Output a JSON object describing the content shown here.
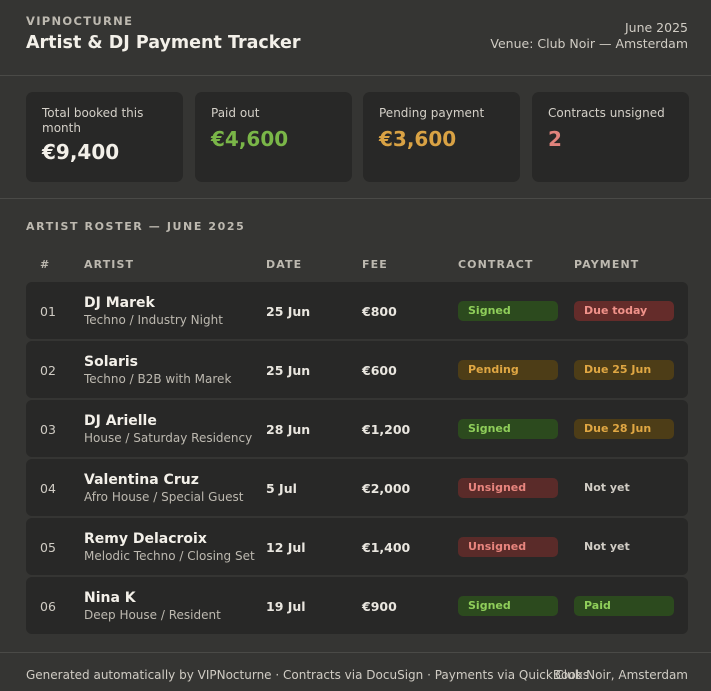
{
  "header": {
    "brand": "VIPNOCTURNE",
    "title": "Artist & DJ Payment Tracker",
    "period": "June 2025",
    "venue": "Venue: Club Noir — Amsterdam"
  },
  "stats": [
    {
      "label": "Total booked this month",
      "value": "€9,400",
      "color": "#f3f0e9"
    },
    {
      "label": "Paid out",
      "value": "€4,600",
      "color": "#7ab648"
    },
    {
      "label": "Pending payment",
      "value": "€3,600",
      "color": "#d9a244"
    },
    {
      "label": "Contracts unsigned",
      "value": "2",
      "color": "#e0837c"
    }
  ],
  "roster": {
    "title": "ARTIST ROSTER — JUNE 2025",
    "columns": [
      "#",
      "ARTIST",
      "DATE",
      "FEE",
      "CONTRACT",
      "PAYMENT"
    ],
    "rows": [
      {
        "num": "01",
        "name": "DJ Marek",
        "genre": "Techno / Industry Night",
        "date": "25 Jun",
        "fee": "€800",
        "contract": "Signed",
        "payment": "Due today"
      },
      {
        "num": "02",
        "name": "Solaris",
        "genre": "Techno / B2B with Marek",
        "date": "25 Jun",
        "fee": "€600",
        "contract": "Pending",
        "payment": "Due 25 Jun"
      },
      {
        "num": "03",
        "name": "DJ Arielle",
        "genre": "House / Saturday Residency",
        "date": "28 Jun",
        "fee": "€1,200",
        "contract": "Signed",
        "payment": "Due 28 Jun"
      },
      {
        "num": "04",
        "name": "Valentina Cruz",
        "genre": "Afro House / Special Guest",
        "date": "5 Jul",
        "fee": "€2,000",
        "contract": "Unsigned",
        "payment": "Not yet"
      },
      {
        "num": "05",
        "name": "Remy Delacroix",
        "genre": "Melodic Techno / Closing Set",
        "date": "12 Jul",
        "fee": "€1,400",
        "contract": "Unsigned",
        "payment": "Not yet"
      },
      {
        "num": "06",
        "name": "Nina K",
        "genre": "Deep House / Resident",
        "date": "19 Jul",
        "fee": "€900",
        "contract": "Signed",
        "payment": "Paid"
      }
    ]
  },
  "pill_styles": {
    "Signed": {
      "bg": "#2c4a1e",
      "fg": "#8fce5a"
    },
    "Pending": {
      "bg": "#4d3d17",
      "fg": "#e0a743"
    },
    "Unsigned": {
      "bg": "#5a2b29",
      "fg": "#e8857e"
    },
    "Due today": {
      "bg": "#642c2a",
      "fg": "#f0928a"
    },
    "Due 25 Jun": {
      "bg": "#4d3d17",
      "fg": "#e0a743"
    },
    "Due 28 Jun": {
      "bg": "#4d3d17",
      "fg": "#e0a743"
    },
    "Paid": {
      "bg": "#2c4a1e",
      "fg": "#8fce5a"
    }
  },
  "footer": {
    "left": "Generated automatically by VIPNocturne · Contracts via DocuSign · Payments via QuickBooks",
    "right": "Club Noir, Amsterdam"
  }
}
